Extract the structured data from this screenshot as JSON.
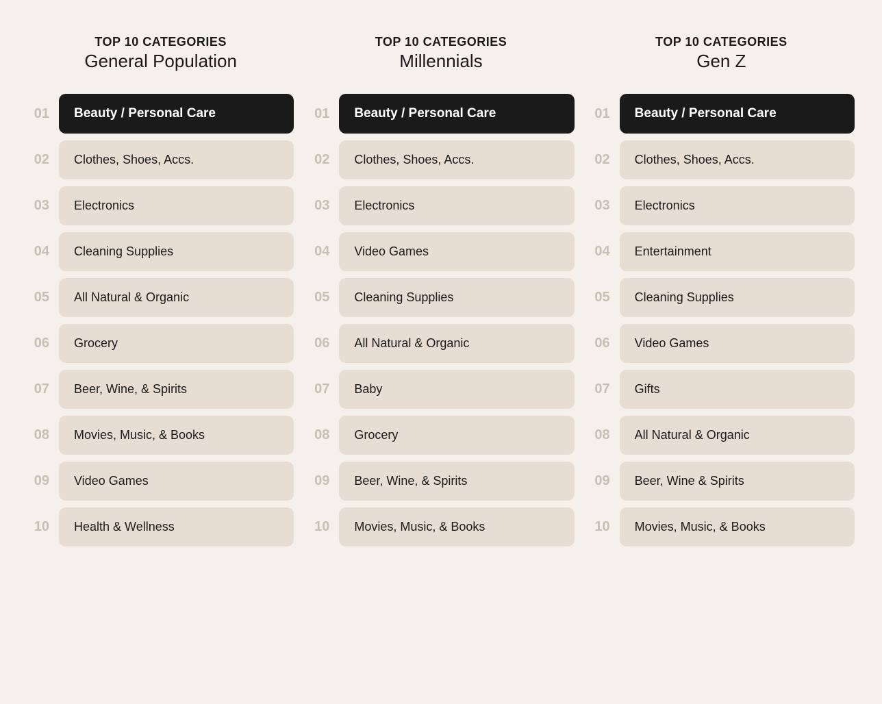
{
  "columns": [
    {
      "id": "general",
      "header_top": "TOP 10 CATEGORIES",
      "header_sub": "General Population",
      "items": [
        {
          "rank": "01",
          "label": "Beauty / Personal Care",
          "highlighted": true
        },
        {
          "rank": "02",
          "label": "Clothes, Shoes, Accs.",
          "highlighted": false
        },
        {
          "rank": "03",
          "label": "Electronics",
          "highlighted": false
        },
        {
          "rank": "04",
          "label": "Cleaning Supplies",
          "highlighted": false
        },
        {
          "rank": "05",
          "label": "All Natural & Organic",
          "highlighted": false
        },
        {
          "rank": "06",
          "label": "Grocery",
          "highlighted": false
        },
        {
          "rank": "07",
          "label": "Beer, Wine, & Spirits",
          "highlighted": false
        },
        {
          "rank": "08",
          "label": "Movies, Music, & Books",
          "highlighted": false
        },
        {
          "rank": "09",
          "label": "Video Games",
          "highlighted": false
        },
        {
          "rank": "10",
          "label": "Health & Wellness",
          "highlighted": false
        }
      ]
    },
    {
      "id": "millennials",
      "header_top": "TOP 10 CATEGORIES",
      "header_sub": "Millennials",
      "items": [
        {
          "rank": "01",
          "label": "Beauty / Personal Care",
          "highlighted": true
        },
        {
          "rank": "02",
          "label": "Clothes, Shoes, Accs.",
          "highlighted": false
        },
        {
          "rank": "03",
          "label": "Electronics",
          "highlighted": false
        },
        {
          "rank": "04",
          "label": "Video Games",
          "highlighted": false
        },
        {
          "rank": "05",
          "label": "Cleaning Supplies",
          "highlighted": false
        },
        {
          "rank": "06",
          "label": "All Natural & Organic",
          "highlighted": false
        },
        {
          "rank": "07",
          "label": "Baby",
          "highlighted": false
        },
        {
          "rank": "08",
          "label": "Grocery",
          "highlighted": false
        },
        {
          "rank": "09",
          "label": "Beer, Wine, & Spirits",
          "highlighted": false
        },
        {
          "rank": "10",
          "label": "Movies, Music, & Books",
          "highlighted": false
        }
      ]
    },
    {
      "id": "genz",
      "header_top": "TOP 10 CATEGORIES",
      "header_sub": "Gen Z",
      "items": [
        {
          "rank": "01",
          "label": "Beauty / Personal Care",
          "highlighted": true
        },
        {
          "rank": "02",
          "label": "Clothes, Shoes, Accs.",
          "highlighted": false
        },
        {
          "rank": "03",
          "label": "Electronics",
          "highlighted": false
        },
        {
          "rank": "04",
          "label": "Entertainment",
          "highlighted": false
        },
        {
          "rank": "05",
          "label": "Cleaning Supplies",
          "highlighted": false
        },
        {
          "rank": "06",
          "label": "Video Games",
          "highlighted": false
        },
        {
          "rank": "07",
          "label": "Gifts",
          "highlighted": false
        },
        {
          "rank": "08",
          "label": "All Natural & Organic",
          "highlighted": false
        },
        {
          "rank": "09",
          "label": "Beer, Wine & Spirits",
          "highlighted": false
        },
        {
          "rank": "10",
          "label": "Movies, Music, & Books",
          "highlighted": false
        }
      ]
    }
  ]
}
